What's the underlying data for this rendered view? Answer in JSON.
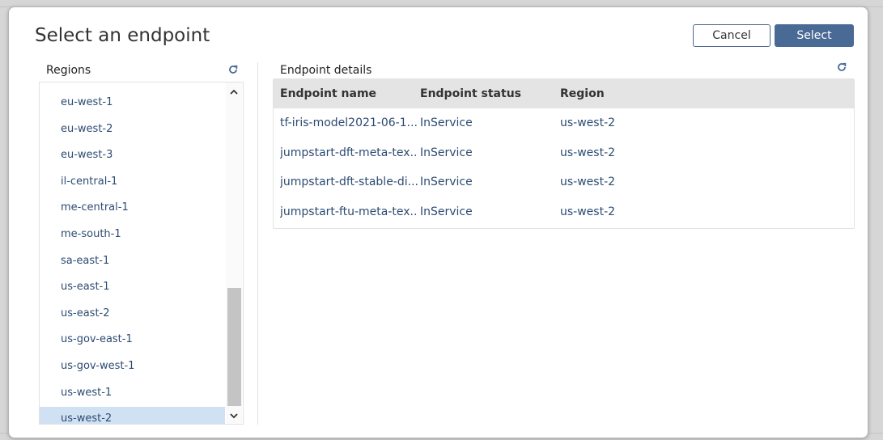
{
  "dialog": {
    "title": "Select an endpoint",
    "cancel_label": "Cancel",
    "select_label": "Select"
  },
  "regions": {
    "label": "Regions",
    "refresh_icon": "refresh-icon",
    "items": [
      {
        "label": "eu-west-1"
      },
      {
        "label": "eu-west-2"
      },
      {
        "label": "eu-west-3"
      },
      {
        "label": "il-central-1"
      },
      {
        "label": "me-central-1"
      },
      {
        "label": "me-south-1"
      },
      {
        "label": "sa-east-1"
      },
      {
        "label": "us-east-1"
      },
      {
        "label": "us-east-2"
      },
      {
        "label": "us-gov-east-1"
      },
      {
        "label": "us-gov-west-1"
      },
      {
        "label": "us-west-1"
      },
      {
        "label": "us-west-2"
      }
    ],
    "selected": "us-west-2"
  },
  "endpoints": {
    "label": "Endpoint details",
    "refresh_icon": "refresh-icon",
    "columns": [
      "Endpoint name",
      "Endpoint status",
      "Region"
    ],
    "rows": [
      {
        "name": "tf-iris-model2021-06-1...",
        "status": "InService",
        "region": "us-west-2"
      },
      {
        "name": "jumpstart-dft-meta-tex...",
        "status": "InService",
        "region": "us-west-2"
      },
      {
        "name": "jumpstart-dft-stable-di...",
        "status": "InService",
        "region": "us-west-2"
      },
      {
        "name": "jumpstart-ftu-meta-tex...",
        "status": "InService",
        "region": "us-west-2"
      }
    ]
  },
  "colors": {
    "accent": "#4a6a96",
    "link_text": "#2d4b72",
    "selected_row": "#cfe1f3",
    "header_bg": "#e4e4e4"
  }
}
